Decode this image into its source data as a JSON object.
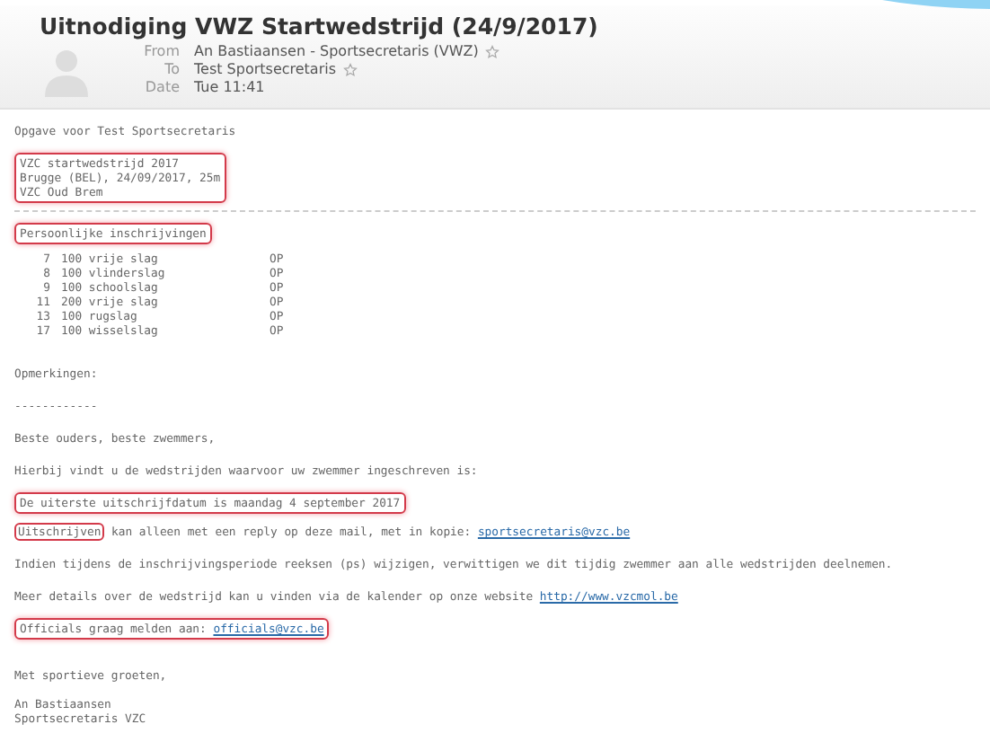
{
  "header": {
    "subject": "Uitnodiging VWZ Startwedstrijd (24/9/2017)",
    "fields": [
      {
        "label": "From",
        "value": "An Bastiaansen - Sportsecretaris (VWZ)",
        "star": true
      },
      {
        "label": "To",
        "value": "Test Sportsecretaris",
        "star": true
      },
      {
        "label": "Date",
        "value": "Tue 11:41",
        "star": false
      }
    ]
  },
  "body": [
    {
      "kind": "text",
      "text": "Opgave voor Test Sportsecretaris",
      "highlighted": false
    },
    {
      "kind": "block",
      "lines": [
        "VZC startwedstrijd 2017",
        "Brugge (BEL), 24/09/2017, 25m",
        "VZC Oud Brem"
      ],
      "highlighted": true
    },
    {
      "kind": "rule"
    },
    {
      "kind": "block",
      "lines": [
        "Persoonlijke inschrijvingen"
      ],
      "highlighted": true
    },
    {
      "kind": "entries",
      "rows": [
        [
          "7",
          "100 vrije slag",
          "OP"
        ],
        [
          "8",
          "100 vlinderslag",
          "OP"
        ],
        [
          "9",
          "100 schoolslag",
          "OP"
        ],
        [
          "11",
          "200 vrije slag",
          "OP"
        ],
        [
          "13",
          "100 rugslag",
          "OP"
        ],
        [
          "17",
          "100 wisselslag",
          "OP"
        ]
      ]
    },
    {
      "kind": "gap"
    },
    {
      "kind": "text",
      "text": "Opmerkingen:",
      "highlighted": false
    },
    {
      "kind": "text",
      "text": "------------",
      "highlighted": false
    },
    {
      "kind": "text",
      "text": "Beste ouders, beste zwemmers,",
      "highlighted": false
    },
    {
      "kind": "text",
      "text": "Hierbij vindt u de wedstrijden waarvoor uw zwemmer ingeschreven is:",
      "highlighted": false
    },
    {
      "kind": "block",
      "lines": [
        "De uiterste uitschrijfdatum is maandag 4 september 2017"
      ],
      "highlighted": true
    },
    {
      "kind": "link_line",
      "lead": "Uitschrijven",
      "text": " kan alleen met een reply op deze mail, met in kopie: ",
      "link": "sportsecretaris@vzc.be"
    },
    {
      "kind": "text",
      "text": "Indien tijdens de inschrijvingsperiode reeksen (ps) wijzigen, verwittigen we dit tijdig zwemmer aan alle wedstrijden deelnemen.",
      "highlighted": false
    },
    {
      "kind": "link_text",
      "text": "Meer details over de wedstrijd kan u vinden via de kalender op onze website ",
      "link": "http://www.vzcmol.be",
      "highlighted": false
    },
    {
      "kind": "link_text",
      "text": "Officials graag melden aan: ",
      "link": "officials@vzc.be",
      "highlighted": true
    },
    {
      "kind": "gap"
    },
    {
      "kind": "text",
      "text": "Met sportieve groeten,",
      "highlighted": false
    },
    {
      "kind": "block",
      "lines": [
        "An Bastiaansen",
        "Sportsecretaris VZC"
      ],
      "highlighted": false
    }
  ]
}
